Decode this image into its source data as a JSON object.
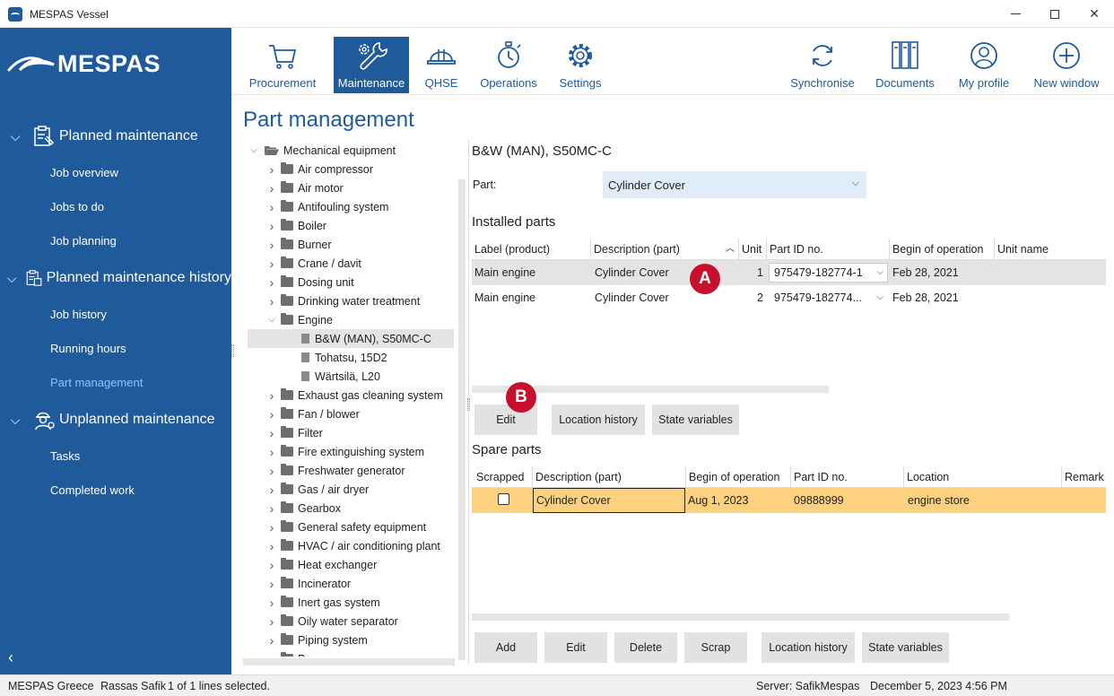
{
  "window": {
    "title": "MESPAS Vessel"
  },
  "sidebar": {
    "logo_text": "MESPAS",
    "sections": [
      {
        "label": "Planned maintenance",
        "icon": "clipboard-wrench-icon",
        "items": [
          "Job overview",
          "Jobs to do",
          "Job planning"
        ]
      },
      {
        "label": "Planned maintenance history",
        "icon": "clipboard-history-icon",
        "items": [
          "Job history",
          "Running hours",
          "Part management"
        ]
      },
      {
        "label": "Unplanned maintenance",
        "icon": "worker-icon",
        "items": [
          "Tasks",
          "Completed work"
        ]
      }
    ],
    "active_item": "Part management"
  },
  "toolbar": {
    "left": [
      {
        "label": "Procurement",
        "icon": "cart-icon"
      },
      {
        "label": "Maintenance",
        "icon": "wrench-gear-icon",
        "active": true
      },
      {
        "label": "QHSE",
        "icon": "hardhat-icon"
      },
      {
        "label": "Operations",
        "icon": "stopwatch-icon"
      },
      {
        "label": "Settings",
        "icon": "gear-icon"
      }
    ],
    "right": [
      {
        "label": "Synchronise",
        "icon": "sync-icon"
      },
      {
        "label": "Documents",
        "icon": "binders-icon"
      },
      {
        "label": "My profile",
        "icon": "user-icon"
      },
      {
        "label": "New window",
        "icon": "plus-circle-icon"
      }
    ]
  },
  "page": {
    "title": "Part management"
  },
  "tree": {
    "root": "Mechanical equipment",
    "items": [
      {
        "label": "Air compressor",
        "level": 1,
        "expanded": false
      },
      {
        "label": "Air motor",
        "level": 1,
        "expanded": false
      },
      {
        "label": "Antifouling system",
        "level": 1,
        "expanded": false
      },
      {
        "label": "Boiler",
        "level": 1,
        "expanded": false
      },
      {
        "label": "Burner",
        "level": 1,
        "expanded": false
      },
      {
        "label": "Crane / davit",
        "level": 1,
        "expanded": false
      },
      {
        "label": "Dosing unit",
        "level": 1,
        "expanded": false
      },
      {
        "label": "Drinking water treatment",
        "level": 1,
        "expanded": false
      },
      {
        "label": "Engine",
        "level": 1,
        "expanded": true
      },
      {
        "label": "B&W (MAN), S50MC-C",
        "level": 2,
        "selected": true
      },
      {
        "label": "Tohatsu, 15D2",
        "level": 2
      },
      {
        "label": "Wärtsilä, L20",
        "level": 2
      },
      {
        "label": "Exhaust gas cleaning system",
        "level": 1,
        "expanded": false
      },
      {
        "label": "Fan / blower",
        "level": 1,
        "expanded": false
      },
      {
        "label": "Filter",
        "level": 1,
        "expanded": false
      },
      {
        "label": "Fire extinguishing system",
        "level": 1,
        "expanded": false
      },
      {
        "label": "Freshwater generator",
        "level": 1,
        "expanded": false
      },
      {
        "label": "Gas / air dryer",
        "level": 1,
        "expanded": false
      },
      {
        "label": "Gearbox",
        "level": 1,
        "expanded": false
      },
      {
        "label": "General safety equipment",
        "level": 1,
        "expanded": false
      },
      {
        "label": "HVAC / air conditioning plant",
        "level": 1,
        "expanded": false
      },
      {
        "label": "Heat exchanger",
        "level": 1,
        "expanded": false
      },
      {
        "label": "Incinerator",
        "level": 1,
        "expanded": false
      },
      {
        "label": "Inert gas system",
        "level": 1,
        "expanded": false
      },
      {
        "label": "Oily water separator",
        "level": 1,
        "expanded": false
      },
      {
        "label": "Piping system",
        "level": 1,
        "expanded": false
      },
      {
        "label": "Pump",
        "level": 1,
        "expanded": false
      }
    ]
  },
  "detail": {
    "title": "B&W (MAN), S50MC-C",
    "part_label": "Part:",
    "part_value": "Cylinder Cover",
    "installed": {
      "title": "Installed parts",
      "columns": [
        "Label (product)",
        "Description (part)",
        "Unit",
        "Part ID no.",
        "Begin of operation",
        "Unit name"
      ],
      "rows": [
        {
          "label": "Main engine",
          "description": "Cylinder Cover",
          "unit": "1",
          "part_id": "975479-182774-1",
          "begin": "Feb 28, 2021",
          "unit_name": ""
        },
        {
          "label": "Main engine",
          "description": "Cylinder Cover",
          "unit": "2",
          "part_id": "975479-182774...",
          "begin": "Feb 28, 2021",
          "unit_name": ""
        }
      ],
      "buttons": [
        "Edit",
        "Location history",
        "State variables"
      ]
    },
    "spare": {
      "title": "Spare parts",
      "columns": [
        "Scrapped",
        "Description (part)",
        "Begin of operation",
        "Part ID no.",
        "Location",
        "Remark"
      ],
      "rows": [
        {
          "scrapped": false,
          "description": "Cylinder Cover",
          "begin": "Aug 1, 2023",
          "part_id": "09888999",
          "location": "engine store",
          "remark": ""
        }
      ],
      "buttons": [
        "Add",
        "Edit",
        "Delete",
        "Scrap",
        "Location history",
        "State variables"
      ]
    }
  },
  "badges": {
    "a": "A",
    "b": "B"
  },
  "status": {
    "company": "MESPAS Greece",
    "user": "Rassas Safik",
    "selection": "1 of 1 lines selected.",
    "server": "Server: SafikMespas",
    "datetime": "December 5, 2023 4:56 PM"
  },
  "colors": {
    "brand": "#1f5a9b",
    "selected_row": "#fdd17f",
    "badge": "#c8102e"
  }
}
